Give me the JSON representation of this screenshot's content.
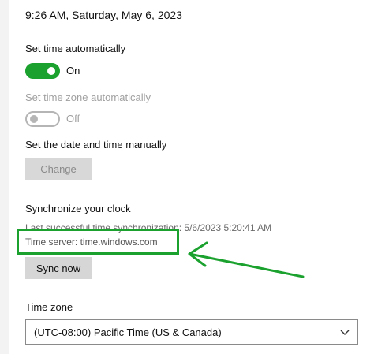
{
  "datetime": {
    "current": "9:26 AM, Saturday, May 6, 2023"
  },
  "set_time_auto": {
    "label": "Set time automatically",
    "state": "On"
  },
  "set_timezone_auto": {
    "label": "Set time zone automatically",
    "state": "Off"
  },
  "manual": {
    "label": "Set the date and time manually",
    "button": "Change"
  },
  "sync": {
    "heading": "Synchronize your clock",
    "last_sync": "Last successful time synchronization: 5/6/2023 5:20:41 AM",
    "server": "Time server: time.windows.com",
    "button": "Sync now"
  },
  "timezone": {
    "label": "Time zone",
    "selected": "(UTC-08:00) Pacific Time (US & Canada)"
  },
  "colors": {
    "accent_green": "#1aa12e",
    "annotation_green": "#1aa12e"
  },
  "icons": {
    "dropdown": "chevron-down-icon",
    "annotation": "arrow-annotation-icon"
  }
}
